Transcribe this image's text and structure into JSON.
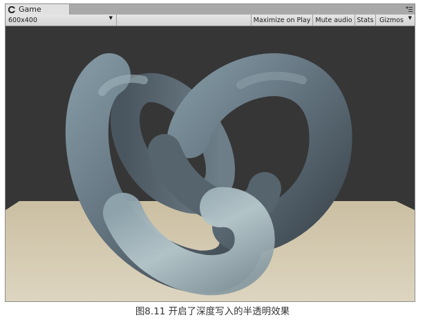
{
  "window": {
    "tab_title": "Game",
    "tab_icon": "unity-game-icon",
    "menu_icon": "tab-menu-icon"
  },
  "toolbar": {
    "resolution": "600x400",
    "maximize_on_play": "Maximize on Play",
    "mute_audio": "Mute audio",
    "stats": "Stats",
    "gizmos": "Gizmos"
  },
  "scene": {
    "background_color": "#363636",
    "ground_color": "#d2c8ad",
    "object_color": "#6f7f8a",
    "object_description_icon": "torus-knot"
  },
  "caption": "图8.11  开启了深度写入的半透明效果"
}
